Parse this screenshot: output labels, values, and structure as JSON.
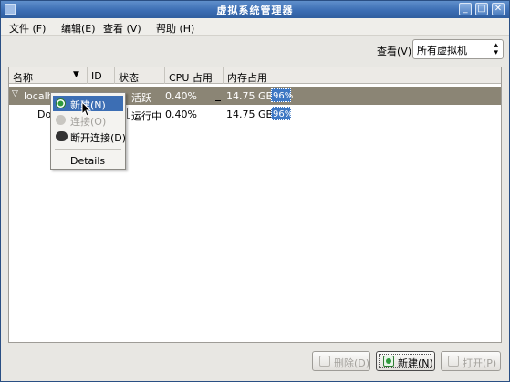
{
  "window": {
    "title": "虚拟系统管理器",
    "controls": {
      "minimize": "_",
      "maximize": "□",
      "close": "✕"
    }
  },
  "menubar": {
    "file": "文件 (F)",
    "edit": "编辑(E)",
    "view": "查看 (V)",
    "help": "帮助 (H)"
  },
  "view_filter": {
    "label": "查看(V):",
    "selected": "所有虚拟机",
    "arrow": "▲▼"
  },
  "table": {
    "columns": {
      "name": "名称",
      "sort_indicator": "▼",
      "id": "ID",
      "status": "状态",
      "cpu": "CPU 占用",
      "memory": "内存占用"
    },
    "rows": [
      {
        "expander": "▽",
        "name": "localh",
        "id": "",
        "status": "活跃",
        "cpu": "0.40%",
        "memory": "14.75 GB",
        "memory_pct": "96%"
      },
      {
        "expander": "",
        "name": "Do",
        "id": "",
        "status": "运行中",
        "cpu": "0.40%",
        "memory": "14.75 GB",
        "memory_pct": "96%"
      }
    ]
  },
  "context_menu": {
    "items": [
      {
        "label": "新建(N)",
        "icon": "new-vm-icon",
        "highlighted": true,
        "enabled": true
      },
      {
        "label": "连接(O)",
        "icon": "connect-icon",
        "highlighted": false,
        "enabled": false
      },
      {
        "label": "断开连接(D)",
        "icon": "disconnect-icon",
        "highlighted": false,
        "enabled": true
      },
      {
        "label": "Details",
        "icon": "",
        "highlighted": false,
        "enabled": true
      }
    ]
  },
  "buttons": {
    "delete": "删除(D)",
    "new": "新建(N)",
    "open": "打开(P)"
  },
  "colors": {
    "titlebar": "#3c6eb4",
    "selection": "#8b8575",
    "highlight": "#3c6eb4"
  }
}
